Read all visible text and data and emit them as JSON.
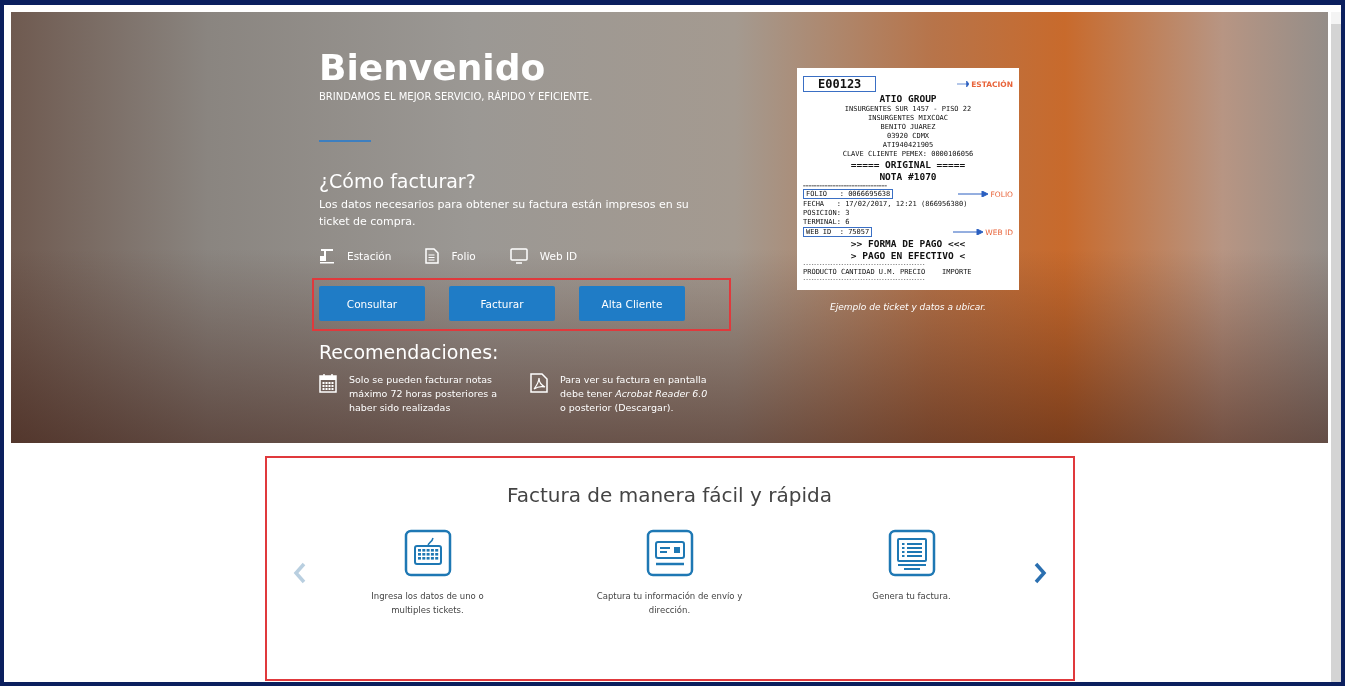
{
  "hero": {
    "title": "Bienvenido",
    "subtitle": "BRINDAMOS EL MEJOR SERVICIO, RÁPIDO Y EFICIENTE.",
    "how_title": "¿Cómo facturar?",
    "how_text": "Los datos necesarios para obtener su factura están impresos en su ticket de compra.",
    "data_items": [
      {
        "kind": "station",
        "label": "Estación"
      },
      {
        "kind": "folio",
        "label": "Folio"
      },
      {
        "kind": "webid",
        "label": "Web ID"
      }
    ],
    "buttons": [
      "Consultar",
      "Facturar",
      "Alta Cliente"
    ],
    "recommendations_title": "Recomendaciones:",
    "recommendations": [
      {
        "kind": "calendar",
        "before": "Solo se pueden facturar notas máximo 72 horas posteriores a haber sido realizadas"
      },
      {
        "kind": "pdf",
        "before": "Para ver su factura en pantalla debe tener *Acrobat Reader 6.0* o posterior (",
        "link": "Descargar",
        "after": ")."
      }
    ]
  },
  "ticket": {
    "lines": [
      {
        "kind": "boxed-big",
        "text": "E00123",
        "tag": "ESTACIÓN"
      },
      {
        "kind": "big",
        "text": "ATIO GROUP"
      },
      {
        "kind": "center",
        "text": "INSURGENTES SUR 1457 - PISO 22"
      },
      {
        "kind": "center",
        "text": "INSURGENTES MIXCOAC"
      },
      {
        "kind": "center",
        "text": "BENITO JUAREZ"
      },
      {
        "kind": "center",
        "text": "03920 CDMX"
      },
      {
        "kind": "center",
        "text": "ATI940421905"
      },
      {
        "kind": "center",
        "text": "CLAVE CLIENTE PEMEX: 0000106056"
      },
      {
        "kind": "big",
        "text": "===== ORIGINAL ====="
      },
      {
        "kind": "big",
        "text": "NOTA #1070"
      },
      {
        "kind": "rule",
        "text": "==============================="
      },
      {
        "kind": "boxed",
        "text": "FOLIO   : 0066695638",
        "tag": "FOLIO"
      },
      {
        "kind": "left",
        "text": "FECHA   : 17/02/2017, 12:21 (866956380)"
      },
      {
        "kind": "left",
        "text": "POSICION: 3"
      },
      {
        "kind": "left",
        "text": "TERMINAL: 6"
      },
      {
        "kind": "boxed",
        "text": "WEB ID  : 75057",
        "tag": "WEB ID"
      },
      {
        "kind": "big",
        "text": ">> FORMA DE PAGO <<<"
      },
      {
        "kind": "big",
        "text": "> PAGO EN EFECTIVO <"
      },
      {
        "kind": "rule",
        "text": "---------------------------------------------"
      },
      {
        "kind": "left",
        "text": "PRODUCTO CANTIDAD U.M. PRECIO    IMPORTE"
      },
      {
        "kind": "rule",
        "text": "---------------------------------------------"
      }
    ],
    "caption": "Ejemplo de ticket y datos a ubicar."
  },
  "features": {
    "title": "Factura de manera fácil y rápida",
    "prev_disabled": true,
    "next_disabled": false,
    "steps": [
      {
        "kind": "keyboard",
        "text": "Ingresa los datos de uno o multiples tickets."
      },
      {
        "kind": "card",
        "text": "Captura tu información de envío y dirección."
      },
      {
        "kind": "monitor",
        "text": "Genera tu factura."
      }
    ]
  }
}
